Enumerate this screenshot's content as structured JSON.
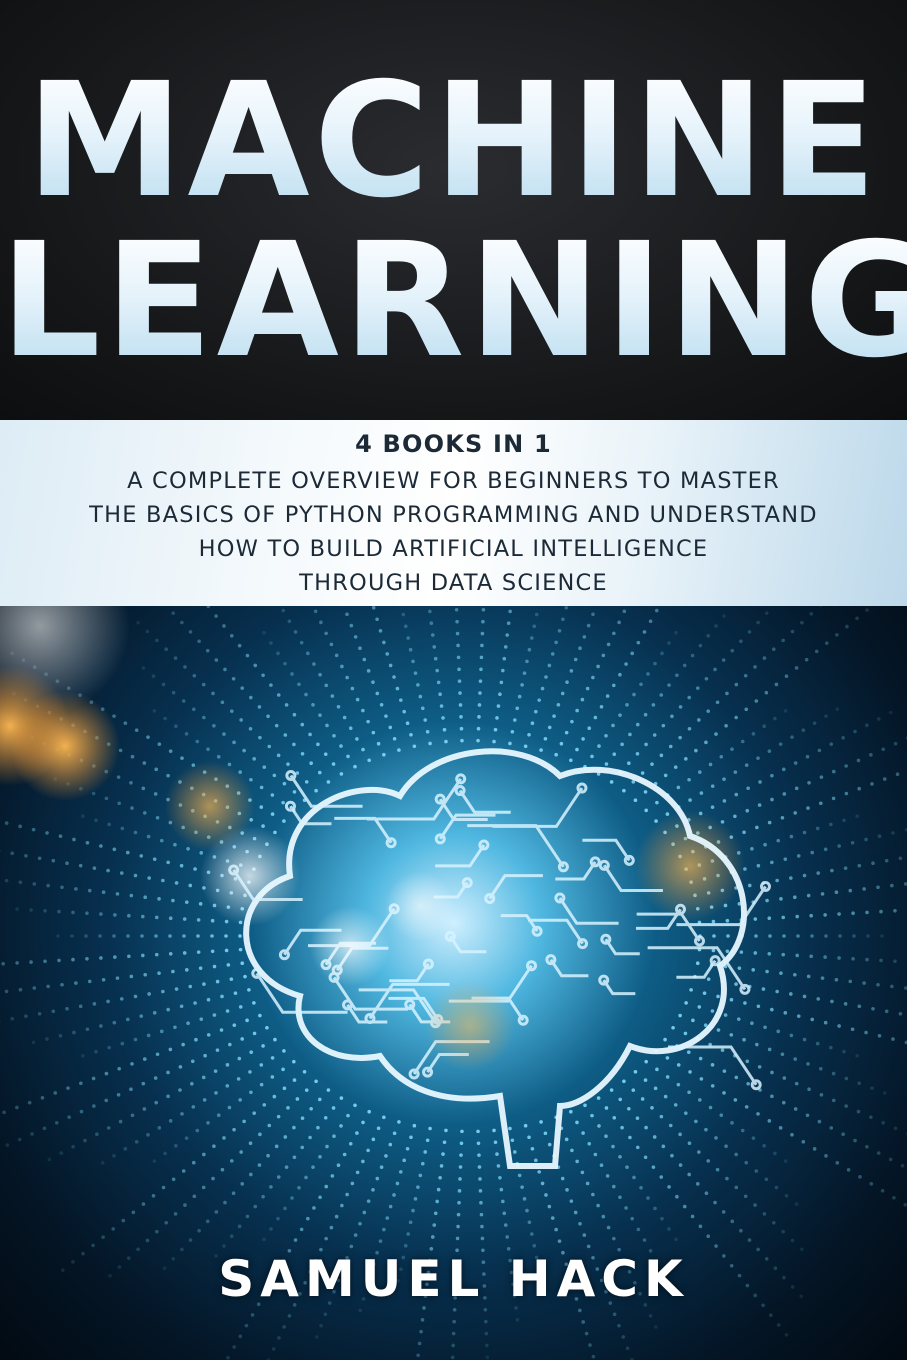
{
  "cover": {
    "title_line1": "MACHINE",
    "title_line2": "LEARNING",
    "subtitle": {
      "series": "4 BOOKS IN 1",
      "lines": [
        "A COMPLETE OVERVIEW FOR BEGINNERS TO MASTER",
        "THE BASICS OF PYTHON PROGRAMMING AND UNDERSTAND",
        "HOW TO BUILD ARTIFICIAL INTELLIGENCE",
        "THROUGH DATA SCIENCE"
      ]
    },
    "author": "SAMUEL HACK",
    "colors": {
      "top_band": "#151618",
      "subtitle_band": "#f4f9fc",
      "subtitle_text": "#1c2a38",
      "glow": "#4fb7e0",
      "bokeh_orange": "#f0a040"
    }
  }
}
